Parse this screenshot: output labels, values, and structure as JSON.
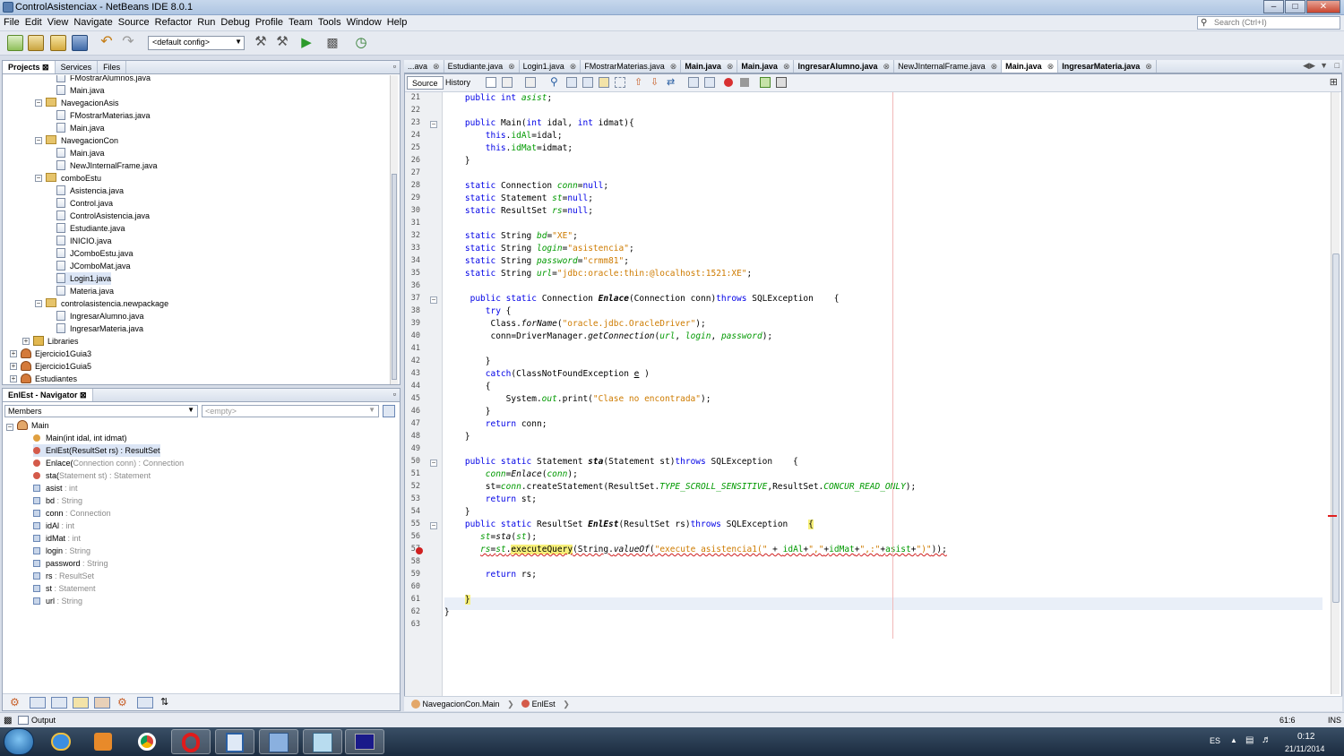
{
  "window": {
    "title": "ControlAsistenciax - NetBeans IDE 8.0.1"
  },
  "menu": [
    "File",
    "Edit",
    "View",
    "Navigate",
    "Source",
    "Refactor",
    "Run",
    "Debug",
    "Profile",
    "Team",
    "Tools",
    "Window",
    "Help"
  ],
  "search": {
    "placeholder": "Search (Ctrl+I)"
  },
  "toolbar": {
    "config": "<default config>"
  },
  "projects": {
    "tabs": [
      "Projects",
      "Services",
      "Files"
    ],
    "tree": [
      {
        "label": "FMostrarAlumnos.java",
        "type": "file",
        "indent": 3
      },
      {
        "label": "Main.java",
        "type": "file",
        "indent": 3
      },
      {
        "label": "NavegacionAsis",
        "type": "package",
        "indent": 2
      },
      {
        "label": "FMostrarMaterias.java",
        "type": "file",
        "indent": 3
      },
      {
        "label": "Main.java",
        "type": "file",
        "indent": 3
      },
      {
        "label": "NavegacionCon",
        "type": "package",
        "indent": 2
      },
      {
        "label": "Main.java",
        "type": "file",
        "indent": 3
      },
      {
        "label": "NewJInternalFrame.java",
        "type": "file",
        "indent": 3
      },
      {
        "label": "comboEstu",
        "type": "package",
        "indent": 2
      },
      {
        "label": "Asistencia.java",
        "type": "file",
        "indent": 3
      },
      {
        "label": "Control.java",
        "type": "file",
        "indent": 3
      },
      {
        "label": "ControlAsistencia.java",
        "type": "file",
        "indent": 3
      },
      {
        "label": "Estudiante.java",
        "type": "file",
        "indent": 3
      },
      {
        "label": "INICIO.java",
        "type": "file",
        "indent": 3
      },
      {
        "label": "JComboEstu.java",
        "type": "file",
        "indent": 3
      },
      {
        "label": "JComboMat.java",
        "type": "file",
        "indent": 3
      },
      {
        "label": "Login1.java",
        "type": "file",
        "indent": 3,
        "selected": true
      },
      {
        "label": "Materia.java",
        "type": "file",
        "indent": 3
      },
      {
        "label": "controlasistencia.newpackage",
        "type": "package",
        "indent": 2
      },
      {
        "label": "IngresarAlumno.java",
        "type": "file",
        "indent": 3
      },
      {
        "label": "IngresarMateria.java",
        "type": "file",
        "indent": 3
      },
      {
        "label": "Libraries",
        "type": "library",
        "indent": 1
      },
      {
        "label": "Ejercicio1Guia3",
        "type": "project",
        "indent": 0
      },
      {
        "label": "Ejercicio1Guia5",
        "type": "project",
        "indent": 0
      },
      {
        "label": "Estudiantes",
        "type": "project",
        "indent": 0
      }
    ]
  },
  "navigator": {
    "title": "EnlEst - Navigator",
    "filter": "Members",
    "empty": "<empty>",
    "root": "Main",
    "members": [
      {
        "name": "Main(",
        "sig": "int idal, int idmat)",
        "type": "",
        "kind": "ctor"
      },
      {
        "name": "EnlEst(ResultSet rs) : ResultSet",
        "sig": "",
        "type": "",
        "kind": "method",
        "selected": true
      },
      {
        "name": "Enlace(",
        "sig": "Connection conn) : ",
        "type": "Connection",
        "kind": "method"
      },
      {
        "name": "sta(",
        "sig": "Statement st) : ",
        "type": "Statement",
        "kind": "method"
      },
      {
        "name": "asist",
        "sig": " : ",
        "type": "int",
        "kind": "field"
      },
      {
        "name": "bd",
        "sig": " : ",
        "type": "String",
        "kind": "field"
      },
      {
        "name": "conn",
        "sig": " : ",
        "type": "Connection",
        "kind": "field"
      },
      {
        "name": "idAl",
        "sig": " : ",
        "type": "int",
        "kind": "field"
      },
      {
        "name": "idMat",
        "sig": " : ",
        "type": "int",
        "kind": "field"
      },
      {
        "name": "login",
        "sig": " : ",
        "type": "String",
        "kind": "field"
      },
      {
        "name": "password",
        "sig": " : ",
        "type": "String",
        "kind": "field"
      },
      {
        "name": "rs",
        "sig": " : ",
        "type": "ResultSet",
        "kind": "field"
      },
      {
        "name": "st",
        "sig": " : ",
        "type": "Statement",
        "kind": "field"
      },
      {
        "name": "url",
        "sig": " : ",
        "type": "String",
        "kind": "field"
      }
    ]
  },
  "editor": {
    "tabs": [
      {
        "label": "...ava",
        "bold": false
      },
      {
        "label": "Estudiante.java",
        "bold": false
      },
      {
        "label": "Login1.java",
        "bold": false
      },
      {
        "label": "FMostrarMaterias.java",
        "bold": false
      },
      {
        "label": "Main.java",
        "bold": true
      },
      {
        "label": "Main.java",
        "bold": true
      },
      {
        "label": "IngresarAlumno.java",
        "bold": true
      },
      {
        "label": "NewJInternalFrame.java",
        "bold": false
      },
      {
        "label": "Main.java",
        "bold": true,
        "active": true
      },
      {
        "label": "IngresarMateria.java",
        "bold": true
      }
    ],
    "source_label": "Source",
    "history_label": "History",
    "lines": [
      {
        "n": "21",
        "html": "    <span class='kw'>public int</span> <span class='fld it'>asist</span>;"
      },
      {
        "n": "22",
        "html": ""
      },
      {
        "n": "23",
        "html": "    <span class='kw'>public</span> Main(<span class='kw'>int</span> idal, <span class='kw'>int</span> idmat){"
      },
      {
        "n": "24",
        "html": "        <span class='kw'>this</span>.<span class='fld'>idAl</span>=idal;"
      },
      {
        "n": "25",
        "html": "        <span class='kw'>this</span>.<span class='fld'>idMat</span>=idmat;"
      },
      {
        "n": "26",
        "html": "    }"
      },
      {
        "n": "27",
        "html": ""
      },
      {
        "n": "28",
        "html": "    <span class='kw'>static</span> Connection <span class='cst'>conn</span>=<span class='kw'>null</span>;"
      },
      {
        "n": "29",
        "html": "    <span class='kw'>static</span> Statement <span class='cst'>st</span>=<span class='kw'>null</span>;"
      },
      {
        "n": "30",
        "html": "    <span class='kw'>static</span> ResultSet <span class='cst'>rs</span>=<span class='kw'>null</span>;"
      },
      {
        "n": "31",
        "html": ""
      },
      {
        "n": "32",
        "html": "    <span class='kw'>static</span> String <span class='cst'>bd</span>=<span class='str'>\"XE\"</span>;"
      },
      {
        "n": "33",
        "html": "    <span class='kw'>static</span> String <span class='cst'>login</span>=<span class='str'>\"asistencia\"</span>;"
      },
      {
        "n": "34",
        "html": "    <span class='kw'>static</span> String <span class='cst'>password</span>=<span class='str'>\"crmm81\"</span>;"
      },
      {
        "n": "35",
        "html": "    <span class='kw'>static</span> String <span class='cst'>url</span>=<span class='str'>\"jdbc:oracle:thin:@localhost:1521:XE\"</span>;"
      },
      {
        "n": "36",
        "html": ""
      },
      {
        "n": "37",
        "html": "     <span class='kw'>public static</span> Connection <b class='it'>Enlace</b>(Connection conn)<span class='kw'>throws</span> SQLException    {"
      },
      {
        "n": "38",
        "html": "        <span class='kw'>try</span> {"
      },
      {
        "n": "39",
        "html": "         Class.<span class='it'>forName</span>(<span class='str'>\"oracle.jdbc.OracleDriver\"</span>);"
      },
      {
        "n": "40",
        "html": "         conn=DriverManager.<span class='it'>getConnection</span>(<span class='cst'>url</span>, <span class='cst'>login</span>, <span class='cst'>password</span>);"
      },
      {
        "n": "41",
        "html": ""
      },
      {
        "n": "42",
        "html": "        }"
      },
      {
        "n": "43",
        "html": "        <span class='kw'>catch</span>(ClassNotFoundException <u>e</u> )"
      },
      {
        "n": "44",
        "html": "        {"
      },
      {
        "n": "45",
        "html": "            System.<span class='cst'>out</span>.print(<span class='str'>\"Clase no encontrada\"</span>);"
      },
      {
        "n": "46",
        "html": "        }"
      },
      {
        "n": "47",
        "html": "        <span class='kw'>return</span> conn;"
      },
      {
        "n": "48",
        "html": "    }"
      },
      {
        "n": "49",
        "html": ""
      },
      {
        "n": "50",
        "html": "    <span class='kw'>public static</span> Statement <b class='it'>sta</b>(Statement st)<span class='kw'>throws</span> SQLException    {"
      },
      {
        "n": "51",
        "html": "        <span class='cst'>conn</span>=<span class='it'>Enlace</span>(<span class='cst'>conn</span>);"
      },
      {
        "n": "52",
        "html": "        st=<span class='cst'>conn</span>.createStatement(ResultSet.<span class='cst'>TYPE_SCROLL_SENSITIVE</span>,ResultSet.<span class='cst'>CONCUR_READ_ONLY</span>);"
      },
      {
        "n": "53",
        "html": "        <span class='kw'>return</span> st;"
      },
      {
        "n": "54",
        "html": "    }"
      },
      {
        "n": "55",
        "html": "    <span class='kw'>public static</span> ResultSet <b class='it'>EnlEst</b>(ResultSet rs)<span class='kw'>throws</span> SQLException    <span style='background:#f7f07a'>{</span>"
      },
      {
        "n": "56",
        "html": "       <span class='cst'>st</span>=<span class='it'>sta</span>(<span class='cst'>st</span>);"
      },
      {
        "n": "57",
        "html": "       <span style='text-decoration:underline wavy #d02020'><span class='cst'>rs</span>=<span class='cst'>st</span>.<span style='background:#f7f07a'>executeQuery</span>(String.<span class='it'>valueOf</span>(<span class='str'>\"execute asistencia1(\"</span> + <span class='fld'>idAl</span>+<span class='str'>\",\"</span>+<span class='fld'>idMat</span>+<span class='str'>\",:\"</span>+<span class='fld'>asist</span>+<span class='str'>\")\"</span>));</span>"
      },
      {
        "n": "58",
        "html": ""
      },
      {
        "n": "59",
        "html": "        <span class='kw'>return</span> rs;"
      },
      {
        "n": "60",
        "html": ""
      },
      {
        "n": "61",
        "html": "    <span style='background:#f7f07a'>}</span>"
      },
      {
        "n": "62",
        "html": "}"
      },
      {
        "n": "63",
        "html": ""
      }
    ],
    "breadcrumbs": [
      "NavegacionCon.Main",
      "EnlEst"
    ]
  },
  "status": {
    "output": "Output",
    "position": "61:6",
    "mode": "INS"
  },
  "taskbar": {
    "lang": "ES",
    "time": "0:12",
    "date": "21/11/2014"
  }
}
